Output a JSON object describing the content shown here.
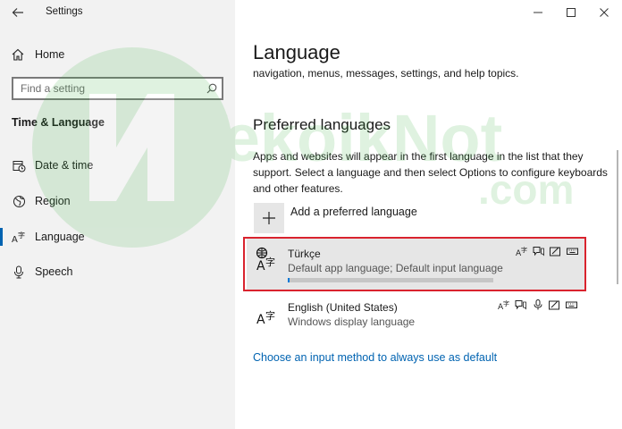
{
  "window": {
    "title": "Settings",
    "controls": [
      "minimize",
      "maximize",
      "close"
    ]
  },
  "sidebar": {
    "home_label": "Home",
    "search_placeholder": "Find a setting",
    "section_title": "Time & Language",
    "items": [
      {
        "label": "Date & time",
        "icon": "date-time-icon",
        "active": false
      },
      {
        "label": "Region",
        "icon": "globe-icon",
        "active": false
      },
      {
        "label": "Language",
        "icon": "language-icon",
        "active": true
      },
      {
        "label": "Speech",
        "icon": "microphone-icon",
        "active": false
      }
    ]
  },
  "main": {
    "title": "Language",
    "cut_text": "navigation, menus, messages, settings, and help topics.",
    "preferred_heading": "Preferred languages",
    "preferred_desc": "Apps and websites will appear in the first language in the list that they support. Select a language and then select Options to configure keyboards and other features.",
    "add_label": "Add a preferred language",
    "languages": [
      {
        "name": "Türkçe",
        "sub": "Default app language; Default input language",
        "progress": 0.01,
        "selected": true,
        "features": [
          "display-language-icon",
          "speech-icon",
          "handwriting-icon",
          "keyboard-icon"
        ]
      },
      {
        "name": "English (United States)",
        "sub": "Windows display language",
        "selected": false,
        "features": [
          "display-language-icon",
          "speech-icon",
          "microphone-icon",
          "handwriting-icon",
          "keyboard-icon"
        ]
      }
    ],
    "input_method_link": "Choose an input method to always use as default"
  },
  "watermark": {
    "text_main": "TekoikNot",
    "text_sub": ".com",
    "color": "#3cb043"
  },
  "colors": {
    "accent": "#0063b1",
    "highlight_border": "#d9232e",
    "sidebar_bg": "#f2f2f2"
  }
}
